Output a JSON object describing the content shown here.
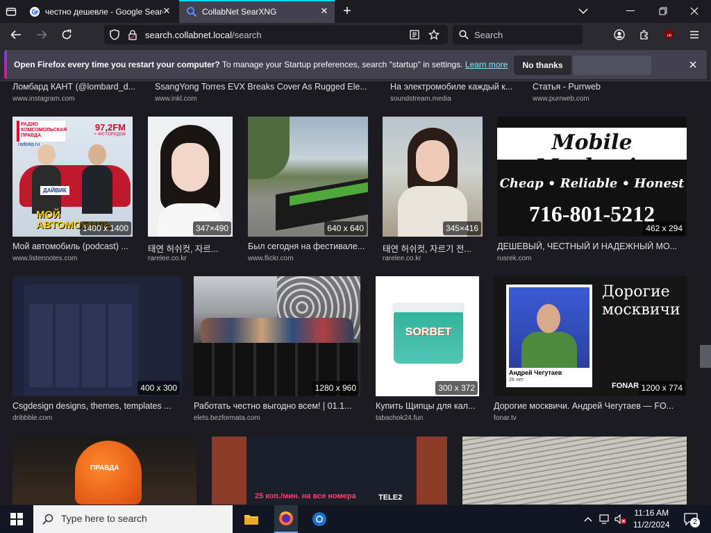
{
  "browser": {
    "tabs": [
      {
        "title": "честно дешевле - Google Search",
        "active": false
      },
      {
        "title": "CollabNet SearXNG",
        "active": true
      }
    ],
    "url_host": "search.collabnet.local",
    "url_path": "/search",
    "search_placeholder": "Search"
  },
  "notification": {
    "bold_text": "Open Firefox every time you restart your computer?",
    "text": " To manage your Startup preferences, search \"startup\" in settings. ",
    "link": "Learn more",
    "no_thanks": "No thanks"
  },
  "results": {
    "row0": [
      {
        "caption": "Ломбард КАНТ (@lombard_d...",
        "domain": "www.instagram.com"
      },
      {
        "caption": "SsangYong Torres EVX Breaks Cover As Rugged Ele...",
        "domain": "www.inkl.com"
      },
      {
        "caption": "На электромобиле каждый к...",
        "domain": "soundstream.media"
      },
      {
        "caption": "Статья - Purrweb",
        "domain": "www.purrweb.com"
      }
    ],
    "row1": [
      {
        "caption": "Мой автомобиль (podcast) ...",
        "domain": "www.listennotes.com",
        "res": "1400 x 1400",
        "poster_top": "РАДИО КОМСОМОЛЬСКАЯ ПРАВДА",
        "poster_freq": "97,2FM",
        "poster_freq_sub": "+ 400 ГОРОДОВ",
        "poster_site": "radiokp.ru",
        "poster_bottom": "МОЙ АВТОМОБИЛЬ",
        "poster_badge": "ДАЙВИК"
      },
      {
        "caption": "태연 허쉬컷, 자르...",
        "domain": "rarelee.co.kr",
        "res": "347×490"
      },
      {
        "caption": "Был сегодня на фестивале...",
        "domain": "www.flickr.com",
        "res": "640 x 640"
      },
      {
        "caption": "태연 허쉬컷, 자르기 전...",
        "domain": "rarelee.co.kr",
        "res": "345×416"
      },
      {
        "caption": "ДЕШЕВЫЙ, ЧЕСТНЫЙ И НАДЕЖНЫЙ МО...",
        "domain": "rusrek.com",
        "res": "462 x 294",
        "ad_title": "Mobile Mechanic",
        "ad_tag": "Cheap • Reliable • Honest",
        "ad_phone": "716-801-5212"
      }
    ],
    "row2": [
      {
        "caption": "Csgdesign designs, themes, templates ...",
        "domain": "dribbble.com",
        "res": "400 x 300"
      },
      {
        "caption": "Работать честно выгодно всем! | 01.1...",
        "domain": "elets.bezformata.com",
        "res": "1280 x 960"
      },
      {
        "caption": "Купить Щипцы для кал...",
        "domain": "tabachok24.fun",
        "res": "300 x 372",
        "product": "SORBET"
      },
      {
        "caption": "Дорогие москвичи. Андрей Чегутаев — FO...",
        "domain": "fonar.tv",
        "res": "1200 x 774",
        "poster_title": "Дорогие москвичи",
        "poster_name": "Андрей Чегутаев",
        "poster_age": "28 лет",
        "poster_brand": "FONAR"
      }
    ],
    "row3": [
      {
        "poster_text": "ПРАВДА"
      },
      {
        "poster_text": "25 коп./мин. на все номера",
        "brand": "TELE2"
      },
      {}
    ]
  },
  "taskbar": {
    "search_placeholder": "Type here to search",
    "time": "11:16 AM",
    "date": "11/2/2024",
    "notif_count": "2"
  }
}
